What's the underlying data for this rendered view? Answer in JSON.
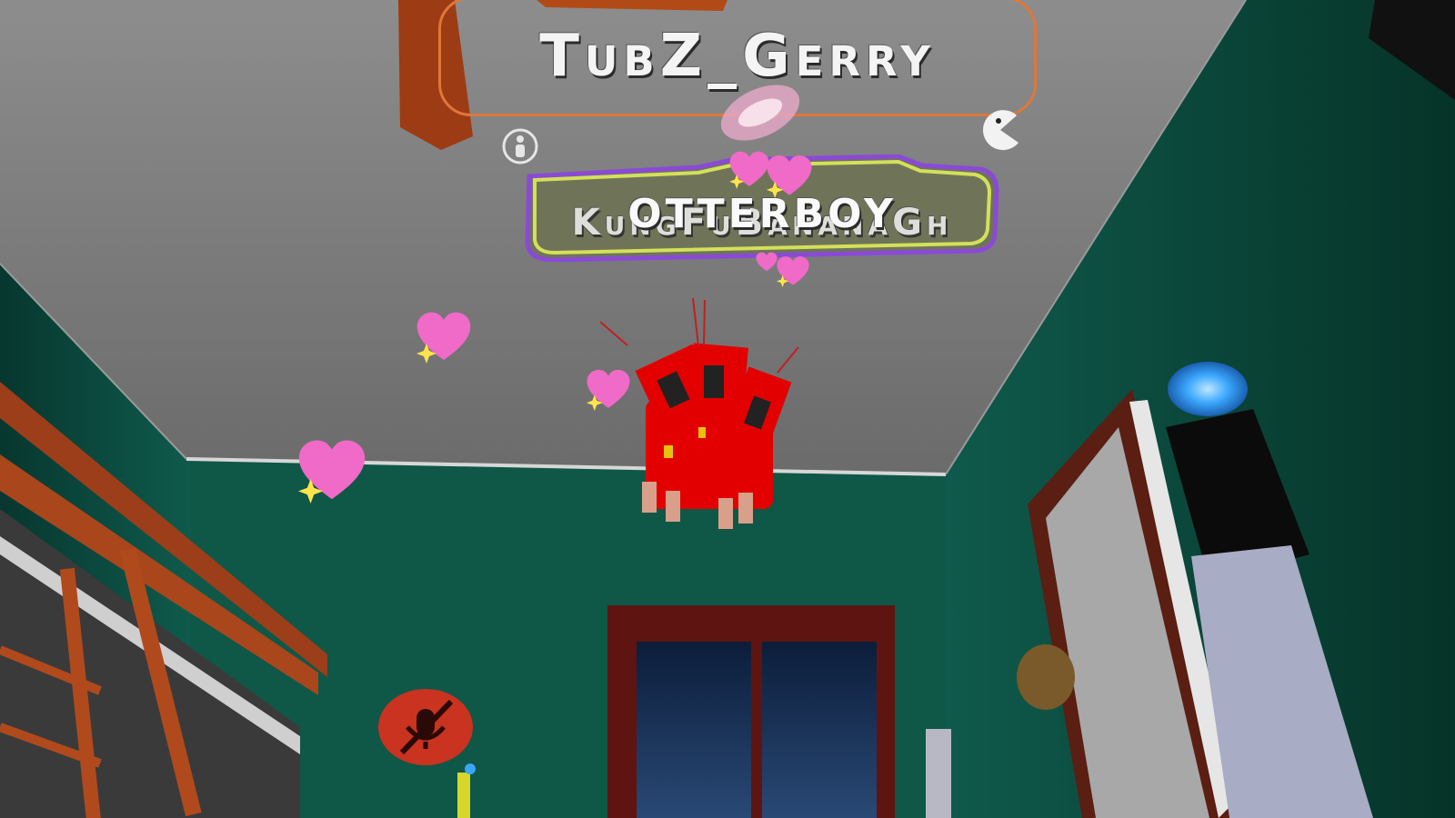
{
  "hud": {
    "player_name": "TubZ_Gerry",
    "nearby_player_name_back": "KungFuBananaGh",
    "nearby_player_name_front": "OTTERBOY",
    "icons": {
      "info": "person-info-icon",
      "pacman": "pacman-icon",
      "mute": "muted-microphone-icon",
      "heart": "sparkling-heart-icon"
    },
    "colors": {
      "main_plate_border": "#e0773a",
      "second_plate_border": "#d4e05a",
      "second_plate_shadow": "#8a4ad6",
      "mute_badge": "#c9331f",
      "heart": "#f06ac8",
      "avatar": "#e00000"
    }
  }
}
